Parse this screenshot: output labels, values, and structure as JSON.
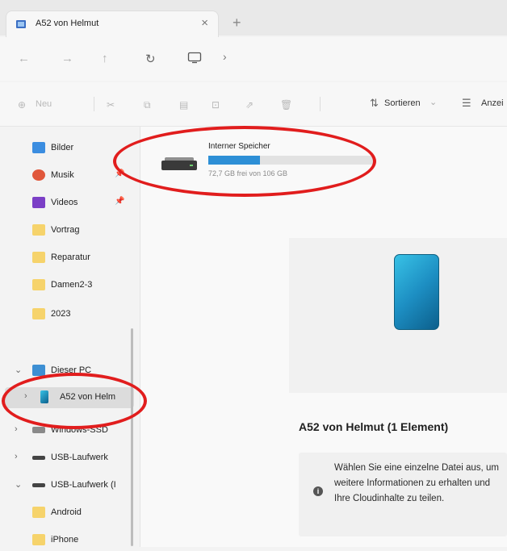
{
  "tab": {
    "title": "A52 von Helmut",
    "close_glyph": "×",
    "new_tab_glyph": "+"
  },
  "nav": {
    "back": "←",
    "forward": "→",
    "up": "↑",
    "refresh": "↻",
    "chevron": "›"
  },
  "toolbar": {
    "new_label": "Neu",
    "sort_label": "Sortieren",
    "view_label": "Anzei"
  },
  "sidebar": {
    "items": [
      {
        "label": "Bilder",
        "icon": "pictures-icon",
        "pinned": false
      },
      {
        "label": "Musik",
        "icon": "music-icon",
        "pinned": true
      },
      {
        "label": "Videos",
        "icon": "videos-icon",
        "pinned": true
      },
      {
        "label": "Vortrag",
        "icon": "folder-icon"
      },
      {
        "label": "Reparatur",
        "icon": "folder-icon"
      },
      {
        "label": "Damen2-3",
        "icon": "folder-icon"
      },
      {
        "label": "2023",
        "icon": "folder-icon"
      },
      {
        "label": "Dieser PC",
        "icon": "this-pc-icon",
        "expanded": true
      },
      {
        "label": "A52 von Helm",
        "icon": "phone-icon",
        "selected": true
      },
      {
        "label": "Windows-SSD",
        "icon": "drive-icon"
      },
      {
        "label": "USB-Laufwerk",
        "icon": "usb-drive-icon"
      },
      {
        "label": "USB-Laufwerk (I",
        "icon": "usb-drive-icon",
        "expanded": true
      },
      {
        "label": "Android",
        "icon": "folder-icon"
      },
      {
        "label": "iPhone",
        "icon": "folder-icon"
      }
    ]
  },
  "drive": {
    "name": "Interner Speicher",
    "free_text": "72,7 GB frei von 106 GB",
    "used_fraction": 0.314
  },
  "details": {
    "title": "A52 von Helmut (1 Element)",
    "info_text": "Wählen Sie eine einzelne Datei aus, um weitere Informationen zu erhalten und Ihre Cloudinhalte zu teilen."
  },
  "colors": {
    "accent": "#2d8fd6",
    "annotation": "#e11d1d",
    "folder": "#f6d36b"
  }
}
